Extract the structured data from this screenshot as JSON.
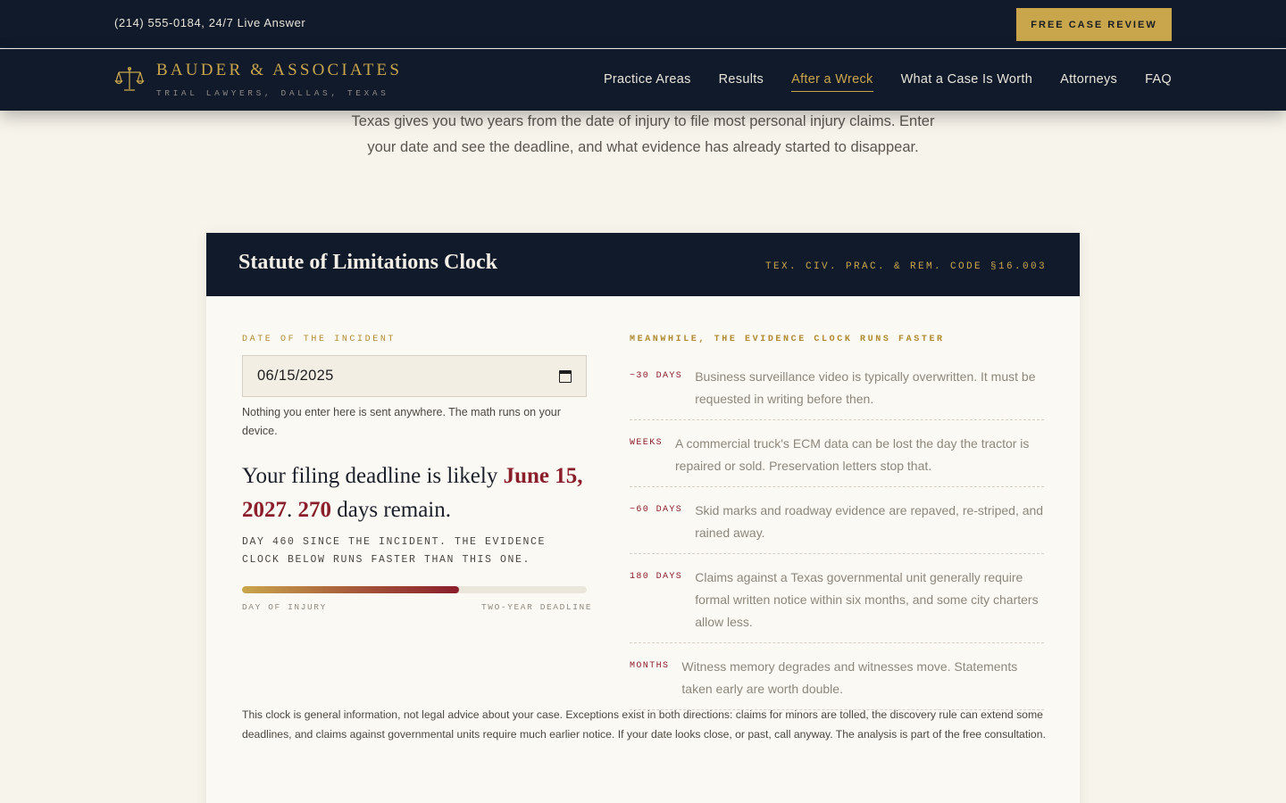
{
  "topbar": {
    "phone": "(214) 555-0184, 24/7 Live Answer",
    "cta_label": "FREE CASE REVIEW"
  },
  "brand": {
    "name": "BAUDER & ASSOCIATES",
    "tagline": "TRIAL LAWYERS, DALLAS, TEXAS",
    "logo_icon": "scales-of-justice-icon"
  },
  "nav": {
    "items": [
      {
        "label": "Practice Areas"
      },
      {
        "label": "Results"
      },
      {
        "label": "After a Wreck",
        "active": true
      },
      {
        "label": "What a Case Is Worth"
      },
      {
        "label": "Attorneys"
      },
      {
        "label": "FAQ"
      }
    ]
  },
  "intro": {
    "text": "Texas gives you two years from the date of injury to file most personal injury claims. Enter your date and see the deadline, and what evidence has already started to disappear."
  },
  "calculator": {
    "title": "Statute of Limitations Clock",
    "citation": "TEX. CIV. PRAC. & REM. CODE §16.003",
    "date_label": "DATE OF THE INCIDENT",
    "date_value": "06/15/2025",
    "privacy_note": "Nothing you enter here is sent anywhere. The math runs on your device.",
    "result": {
      "prefix": "Your filing deadline is likely ",
      "deadline_date": "June 15, 2027",
      "sep": ". ",
      "days_remaining": "270",
      "suffix": " days remain."
    },
    "day_line": "DAY 460 SINCE THE INCIDENT. THE EVIDENCE CLOCK BELOW RUNS FASTER THAN THIS ONE.",
    "progress": {
      "fraction": 0.63,
      "start_label": "DAY OF INJURY",
      "end_label": "TWO-YEAR DEADLINE"
    },
    "evidence": {
      "label": "MEANWHILE, THE EVIDENCE CLOCK RUNS FASTER",
      "items": [
        {
          "tag": "~30 DAYS",
          "text": "Business surveillance video is typically overwritten. It must be requested in writing before then."
        },
        {
          "tag": "WEEKS",
          "text": "A commercial truck's ECM data can be lost the day the tractor is repaired or sold. Preservation letters stop that."
        },
        {
          "tag": "~60 DAYS",
          "text": "Skid marks and roadway evidence are repaved, re-striped, and rained away."
        },
        {
          "tag": "180 DAYS",
          "text": "Claims against a Texas governmental unit generally require formal written notice within six months, and some city charters allow less."
        },
        {
          "tag": "MONTHS",
          "text": "Witness memory degrades and witnesses move. Statements taken early are worth double."
        }
      ]
    },
    "disclaimer": "This clock is general information, not legal advice about your case. Exceptions exist in both directions: claims for minors are tolled, the discovery rule can extend some deadlines, and claims against governmental units require much earlier notice. If your date looks close, or past, call anyway. The analysis is part of the free consultation."
  },
  "colors": {
    "navy": "#101a2a",
    "gold": "#c9a64b",
    "crimson": "#8a1e2b",
    "paper": "#f7f4eb"
  }
}
